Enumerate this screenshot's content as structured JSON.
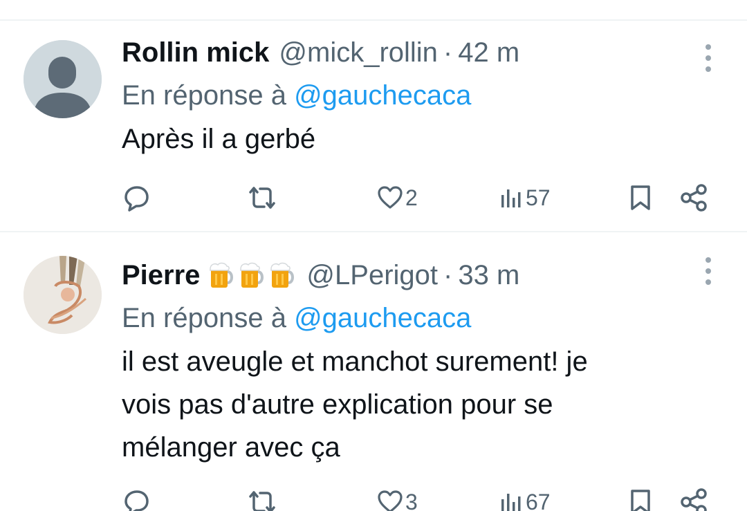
{
  "tweets": [
    {
      "name": "Rollin mick",
      "handle": "@mick_rollin",
      "separator": "·",
      "time": "42 m",
      "reply_prefix": "En réponse à",
      "reply_to": "@gauchecaca",
      "text_lines": [
        "Après il a gerbé"
      ],
      "likes": "2",
      "views": "57",
      "avatar": "default-avatar"
    },
    {
      "name": "Pierre",
      "name_emoji": [
        "beer-mug-emoji",
        "beer-mug-emoji",
        "beer-mug-emoji"
      ],
      "handle": "@LPerigot",
      "separator": "·",
      "time": "33 m",
      "reply_prefix": "En réponse à",
      "reply_to": "@gauchecaca",
      "text_lines": [
        "il est aveugle et manchot surement! je",
        "vois pas d'autre explication pour se",
        "mélanger avec ça"
      ],
      "likes": "3",
      "views": "67",
      "avatar": "drawing-avatar"
    }
  ],
  "colors": {
    "text": "#0f1419",
    "secondary": "#536471",
    "link": "#1d9bf0",
    "divider": "#eff3f4"
  }
}
